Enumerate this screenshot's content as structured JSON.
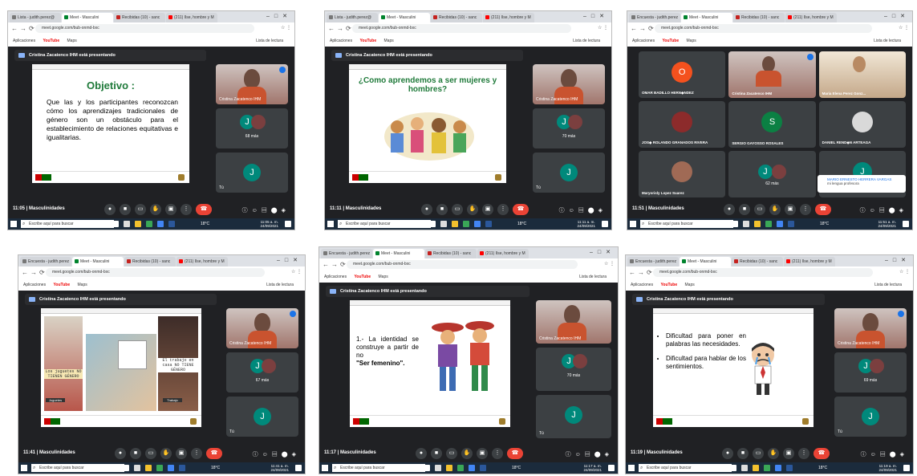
{
  "tabs": [
    "Lista - judith.perez@",
    "Meet - Masculini",
    "Recibidas (10) - sanc",
    "(211) Ilse, hombre y M"
  ],
  "tabs_alt": [
    "Encuesta - judith.perez",
    "Meet - Masculini",
    "Recibidas (10) - sanc",
    "(211) Ilse, hombre y M"
  ],
  "url": "meet.google.com/bub-onmd-bxc",
  "bookmarks": {
    "apps": "Aplicaciones",
    "youtube": "YouTube",
    "maps": "Maps",
    "reading_list": "Lista de lectura"
  },
  "presenting": "Cristina Zacatenco IHM está presentando",
  "presenter_name": "Cristina Zacatenco IHM",
  "meeting_name": "Masculinidades",
  "you_label": "Tú",
  "taskbar": {
    "search": "Escribe aquí para buscar",
    "weather": "18°C",
    "date": "24/09/2021"
  },
  "shots": [
    {
      "time": "11:05",
      "more": "68 más",
      "clock": "11:05 a. m."
    },
    {
      "time": "11:11",
      "more": "70 más",
      "clock": "11:11 a. m."
    },
    {
      "time": "11:51",
      "more": "62 más",
      "clock": "11:51 a. m."
    },
    {
      "time": "11:41",
      "more": "67 más",
      "clock": "11:41 a. m."
    },
    {
      "time": "11:17",
      "more": "70 más",
      "clock": "11:17 a. m."
    },
    {
      "time": "11:19",
      "more": "69 más",
      "clock": "11:19 a. m."
    }
  ],
  "slide1": {
    "title": "Objetivo :",
    "text": "Que las y los participantes reconozcan cómo los aprendizajes tradicionales de género son un obstáculo para el establecimiento de relaciones equitativas e igualitarias."
  },
  "slide2": {
    "title": "¿Como aprendemos a ser mujeres y hombres?"
  },
  "slide4": {
    "cap1": "Los juguetes NO TIENEN GÉNERO",
    "cap2": "El trabajo en casa NO TIENE GÉNERO",
    "tag1": "Juguetes",
    "tag2": "Trabajo"
  },
  "slide5": {
    "text": "1.- La identidad se construye a partir de no",
    "bold": "\"Ser femenino\"."
  },
  "slide6": {
    "b1": "Dificultad para poner en palabras las necesidades.",
    "b2": "Dificultad para hablar de los sentimientos."
  },
  "grid": {
    "p1": {
      "initial": "O",
      "name": "OMAR BADILLO HERN◆NDEZ"
    },
    "p2": {
      "name": "Cristina Zacatenco IHM"
    },
    "p3": {
      "name": "Maria Elena Perez Gonz..."
    },
    "p4": {
      "name": "JOS◆ ROLANDO GRANADOS RIVERA"
    },
    "p5": {
      "initial": "S",
      "name": "SERGIO GAYOSSO ROSALES"
    },
    "p6": {
      "name": "DANIEL REND◆N ARTEAGA"
    },
    "p7": {
      "name": "Maryorisly Lopez Suarez"
    },
    "p8": {
      "more": "62 más"
    },
    "popup_name": "MARIO ERNESTO HERRERA VARGAS",
    "popup_sub": "mi lengua profesora"
  },
  "initial_j": "J",
  "colors": {
    "meet_bg": "#202124",
    "tile": "#3c4043",
    "end_call": "#ea4335",
    "j_avatar": "#00897b",
    "o_avatar": "#f4511e",
    "s_avatar": "#0b8043",
    "slide_green": "#1f7a3a"
  }
}
